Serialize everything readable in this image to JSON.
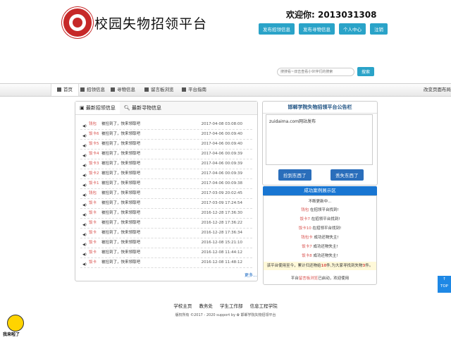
{
  "header": {
    "site_title": "校园失物招领平台",
    "welcome": "欢迎你: 2013031308",
    "buttons": [
      "发布招领信息",
      "发布寻物信息",
      "个人中心",
      "注销"
    ],
    "logo_color": "#c62828",
    "accent_color": "#2aa3c8"
  },
  "search": {
    "placeholder": "搜搜看~双击查看小伙伴们的搜索",
    "button": "搜索"
  },
  "nav": {
    "items": [
      {
        "label": "首页",
        "icon": "home-icon"
      },
      {
        "label": "招领信息",
        "icon": "picture-icon"
      },
      {
        "label": "寻物信息",
        "icon": "search-icon"
      },
      {
        "label": "留言板浏览",
        "icon": "star-icon"
      },
      {
        "label": "平台指南",
        "icon": "info-icon"
      }
    ],
    "right_text": "改变页面布局"
  },
  "left_panel": {
    "tabs": [
      "最新招领信息",
      "最新寻物信息"
    ],
    "rows": [
      {
        "tag": "钱包",
        "msg": "被捡到了，快来领取吧",
        "time": "2017-04-08 03:08:00"
      },
      {
        "tag": "饭卡6",
        "msg": "被捡到了，快来领取吧",
        "time": "2017-04-06 00:09:40"
      },
      {
        "tag": "饭卡5",
        "msg": "被捡到了，快来领取吧",
        "time": "2017-04-06 00:09:40"
      },
      {
        "tag": "饭卡4",
        "msg": "被捡到了，快来领取吧",
        "time": "2017-04-06 00:09:39"
      },
      {
        "tag": "饭卡3",
        "msg": "被捡到了，快来领取吧",
        "time": "2017-04-06 00:09:39"
      },
      {
        "tag": "饭卡2",
        "msg": "被捡到了，快来领取吧",
        "time": "2017-04-06 00:09:39"
      },
      {
        "tag": "饭卡1",
        "msg": "被捡到了，快来领取吧",
        "time": "2017-04-06 00:09:38"
      },
      {
        "tag": "钱包",
        "msg": "被捡到了，快来领取吧",
        "time": "2017-03-09 20:02:45"
      },
      {
        "tag": "饭卡",
        "msg": "被捡到了，快来领取吧",
        "time": "2017-03-09 17:24:54"
      },
      {
        "tag": "饭卡",
        "msg": "被捡到了，快来领取吧",
        "time": "2016-12-28 17:36:30"
      },
      {
        "tag": "饭卡",
        "msg": "被捡到了，快来领取吧",
        "time": "2016-12-28 17:36:22"
      },
      {
        "tag": "饭卡",
        "msg": "被捡到了，快来领取吧",
        "time": "2016-12-28 17:36:34"
      },
      {
        "tag": "饭卡",
        "msg": "被捡到了，快来领取吧",
        "time": "2016-12-08 15:21:10"
      },
      {
        "tag": "饭卡",
        "msg": "被捡到了，快来领取吧",
        "time": "2016-12-08 11:44:12"
      },
      {
        "tag": "饭卡",
        "msg": "被捡到了，快来领取吧",
        "time": "2016-12-08 11:48:12"
      }
    ],
    "more": "更多..."
  },
  "announcement": {
    "title": "邯郸学院失物招领平台公告栏",
    "content": "zuidaima.com网站发布",
    "btn_found": "捡到东西了",
    "btn_lost": "丢失东西了"
  },
  "cases": {
    "title": "成功案例展示区",
    "subtitle": "不断更新中...",
    "items": [
      {
        "item": "钱包",
        "text": "在招领平台找到!"
      },
      {
        "item": "饭卡7",
        "text": "在招领平台找到!"
      },
      {
        "item": "饭卡10",
        "text": "在招领平台找到!"
      },
      {
        "item": "钱包卡",
        "text": "成功还物失主!"
      },
      {
        "item": "饭卡7",
        "text": "成功还物失主!"
      },
      {
        "item": "饭卡8",
        "text": "成功还物失主!"
      }
    ],
    "stats_pre": "该平台使用至今，累计归还物给",
    "stats_n1": "10",
    "stats_mid": "件,为大家寻找到失物",
    "stats_n2": "3",
    "stats_post": "件。",
    "note_pre": "平台",
    "note_link": "留言板浏览",
    "note_post": "已启动，欢迎使用"
  },
  "footer": {
    "links": [
      "学校主页",
      "教务处",
      "学生工作部",
      "信息工程学院"
    ],
    "copyright": "版权所有 ©2017 - 2020 support by",
    "copyright_org": "邯郸学院失物招领平台"
  },
  "totop": {
    "line1": "↑",
    "line2": "TOP"
  },
  "mascot": {
    "label": "我来啦了"
  }
}
